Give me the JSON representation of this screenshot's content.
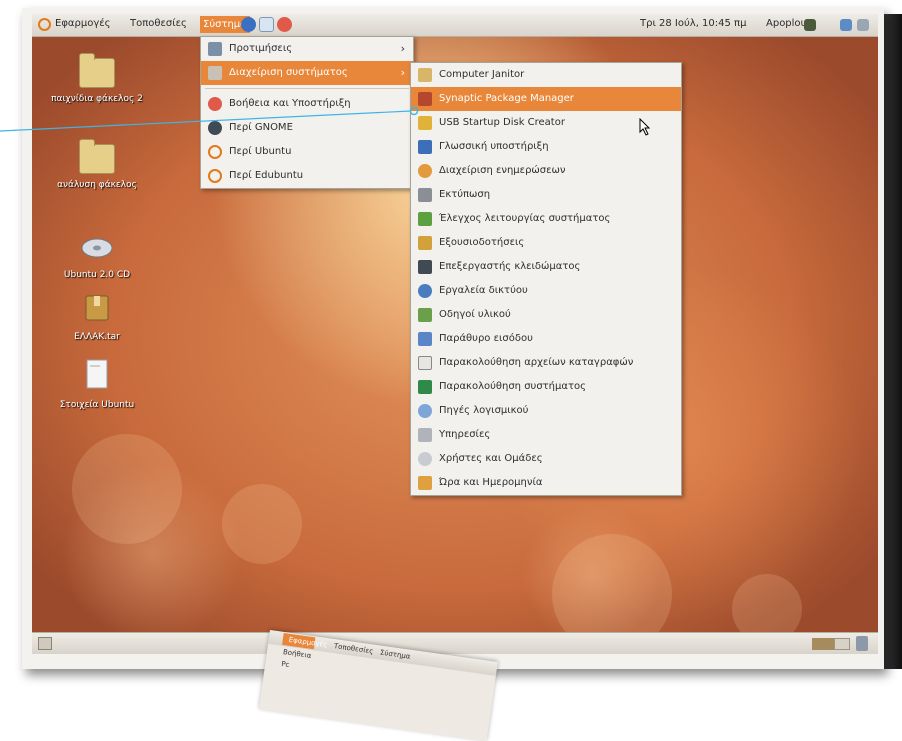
{
  "top_panel": {
    "menus": [
      "Εφαρμογές",
      "Τοποθεσίες",
      "Σύστημα"
    ],
    "clock": "Τρι 28 Ιούλ, 10:45 πμ",
    "user": "Apoplous"
  },
  "desktop_icons": [
    {
      "label": "παιχνίδια φάκελος 2",
      "icon": "folder-icon"
    },
    {
      "label": "ανάλυση φάκελος",
      "icon": "folder-icon"
    },
    {
      "label": "Ubuntu 2.0 CD",
      "icon": "disc-icon"
    },
    {
      "label": "ΕΛΛΑΚ.tar",
      "icon": "archive-icon"
    },
    {
      "label": "Στοιχεία Ubuntu",
      "icon": "document-icon"
    }
  ],
  "system_menu": {
    "items": [
      {
        "label": "Προτιμήσεις",
        "icon": "preferences-icon",
        "submenu": true
      },
      {
        "label": "Διαχείριση συστήματος",
        "icon": "admin-icon",
        "submenu": true,
        "selected": true
      },
      {
        "label": "Βοήθεια και Υποστήριξη",
        "icon": "help-icon"
      },
      {
        "label": "Περί GNOME",
        "icon": "gnome-icon"
      },
      {
        "label": "Περί Ubuntu",
        "icon": "ubuntu-icon"
      },
      {
        "label": "Περί Edubuntu",
        "icon": "ubuntu-icon"
      }
    ]
  },
  "admin_submenu": {
    "items": [
      {
        "label": "Computer Janitor",
        "icon": "broom-icon"
      },
      {
        "label": "Synaptic Package Manager",
        "icon": "package-icon",
        "selected": true
      },
      {
        "label": "USB Startup Disk Creator",
        "icon": "usb-icon"
      },
      {
        "label": "Γλωσσική υποστήριξη",
        "icon": "flag-icon"
      },
      {
        "label": "Διαχείριση ενημερώσεων",
        "icon": "update-icon"
      },
      {
        "label": "Εκτύπωση",
        "icon": "printer-icon"
      },
      {
        "label": "Έλεγχος λειτουργίας συστήματος",
        "icon": "monitor-icon"
      },
      {
        "label": "Εξουσιοδοτήσεις",
        "icon": "lock-icon"
      },
      {
        "label": "Επεξεργαστής κλειδώματος",
        "icon": "keyboard-icon"
      },
      {
        "label": "Εργαλεία δικτύου",
        "icon": "network-icon"
      },
      {
        "label": "Οδηγοί υλικού",
        "icon": "chip-icon"
      },
      {
        "label": "Παράθυρο εισόδου",
        "icon": "login-icon"
      },
      {
        "label": "Παρακολούθηση αρχείων καταγραφών",
        "icon": "log-icon"
      },
      {
        "label": "Παρακολούθηση συστήματος",
        "icon": "system-monitor-icon"
      },
      {
        "label": "Πηγές λογισμικού",
        "icon": "software-sources-icon"
      },
      {
        "label": "Υπηρεσίες",
        "icon": "services-icon"
      },
      {
        "label": "Χρήστες και Ομάδες",
        "icon": "users-icon"
      },
      {
        "label": "Ώρα και Ημερομηνία",
        "icon": "clock-icon"
      }
    ]
  },
  "mini_screenshot": {
    "menus": [
      "Εφαρμογές",
      "Τοποθεσίες",
      "Σύστημα"
    ],
    "rows": [
      "Βοήθεια",
      "Pc"
    ]
  },
  "colors": {
    "accent": "#e8863a",
    "menu_bg": "#f2f1ee",
    "panel_bg": "#e4e0d8",
    "callout": "#3fb4e6"
  }
}
